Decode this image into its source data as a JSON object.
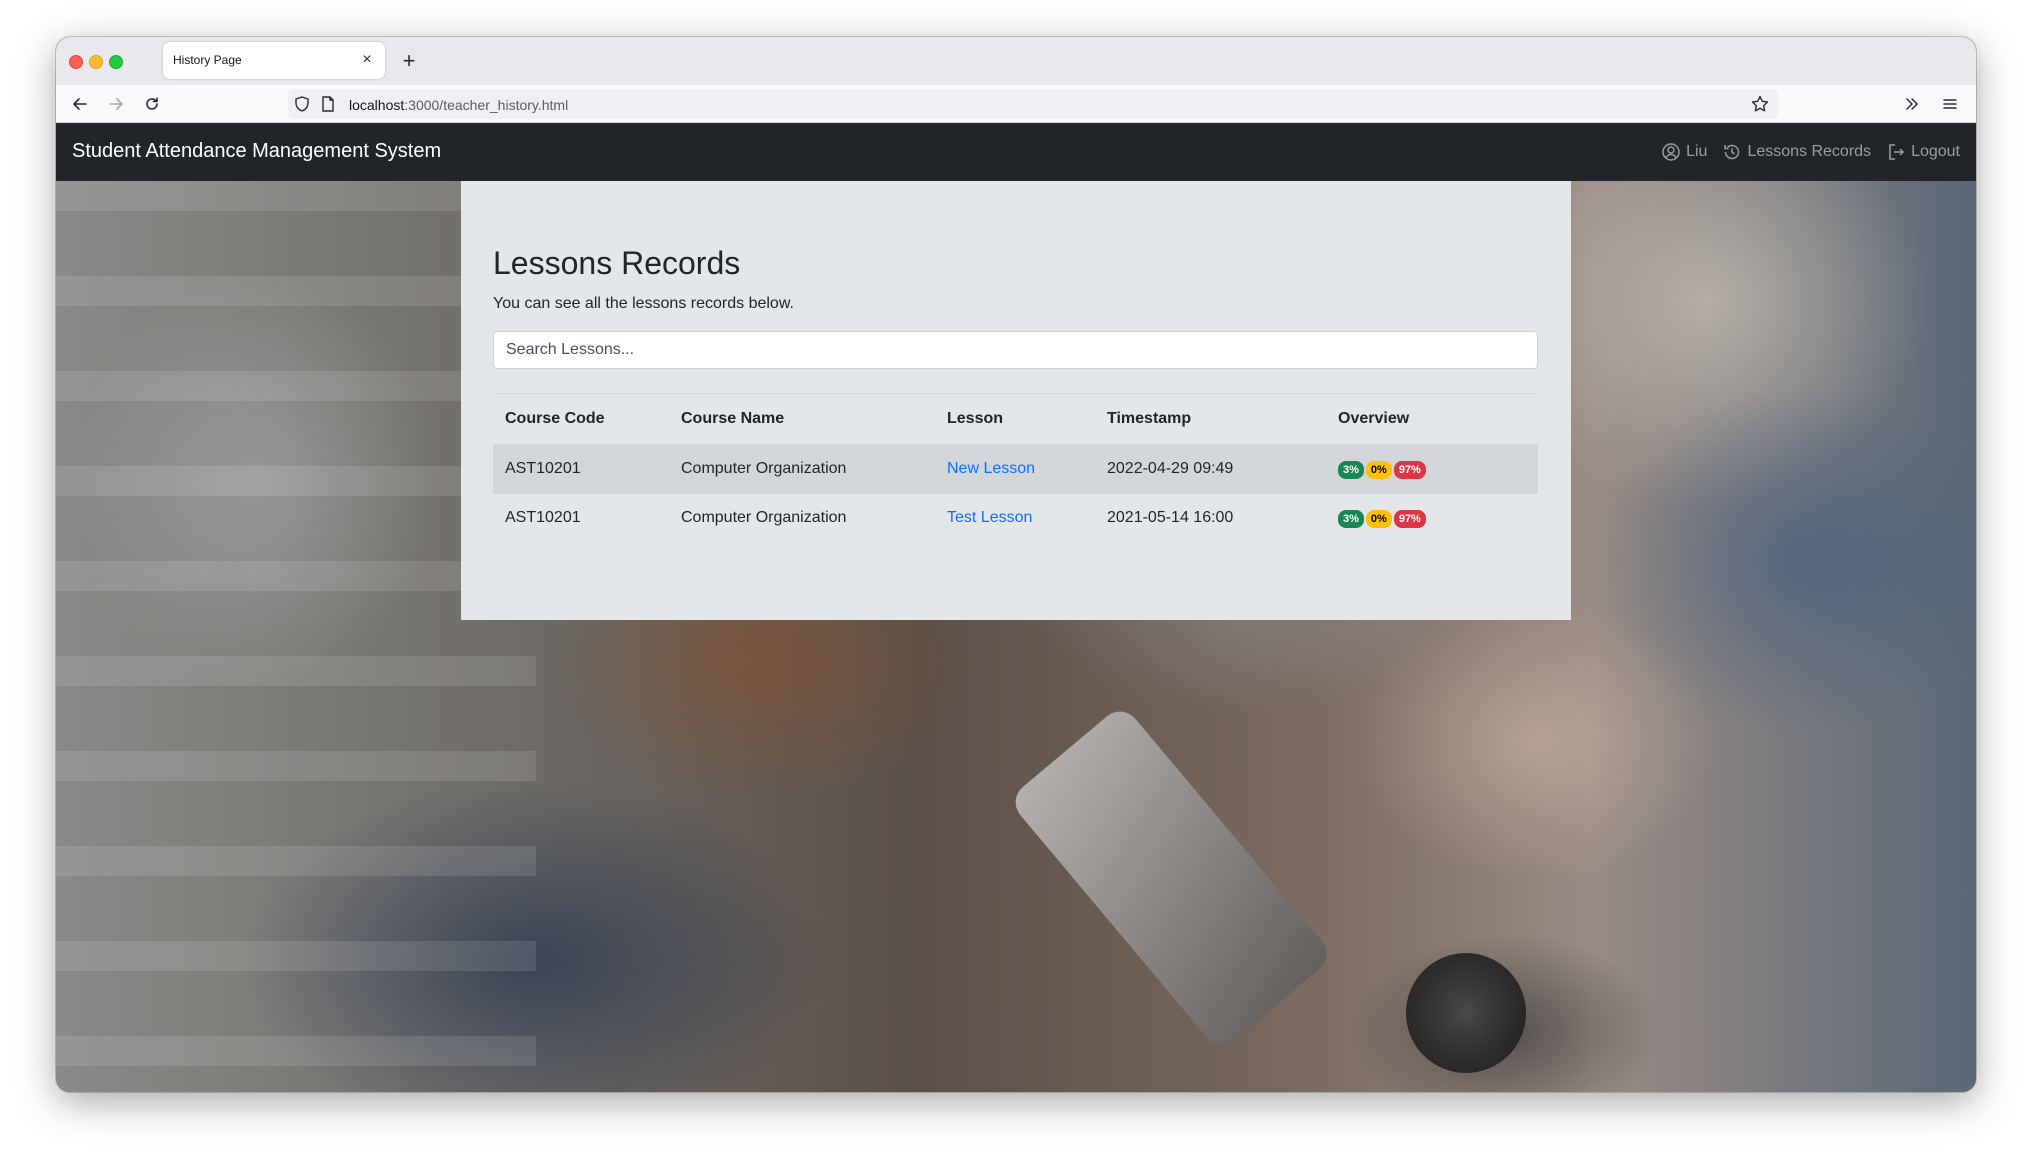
{
  "browser": {
    "tab_title": "History Page",
    "url_host": "localhost",
    "url_rest": ":3000/teacher_history.html"
  },
  "app": {
    "brand": "Student Attendance Management System",
    "nav": {
      "user": "Liu",
      "records": "Lessons Records",
      "logout": "Logout"
    }
  },
  "main": {
    "title": "Lessons Records",
    "subtitle": "You can see all the lessons records below.",
    "search_placeholder": "Search Lessons..."
  },
  "table": {
    "headers": [
      "Course Code",
      "Course Name",
      "Lesson",
      "Timestamp",
      "Overview"
    ],
    "rows": [
      {
        "code": "AST10201",
        "name": "Computer Organization",
        "lesson": "New Lesson",
        "timestamp": "2022-04-29 09:49",
        "present": "3%",
        "late": "0%",
        "absent": "97%"
      },
      {
        "code": "AST10201",
        "name": "Computer Organization",
        "lesson": "Test Lesson",
        "timestamp": "2021-05-14 16:00",
        "present": "3%",
        "late": "0%",
        "absent": "97%"
      }
    ]
  },
  "colors": {
    "navbar": "#212529",
    "card": "#e4e7ea",
    "link": "#0d6efd",
    "badge_green": "#198754",
    "badge_yellow": "#ffc107",
    "badge_red": "#dc3545"
  }
}
